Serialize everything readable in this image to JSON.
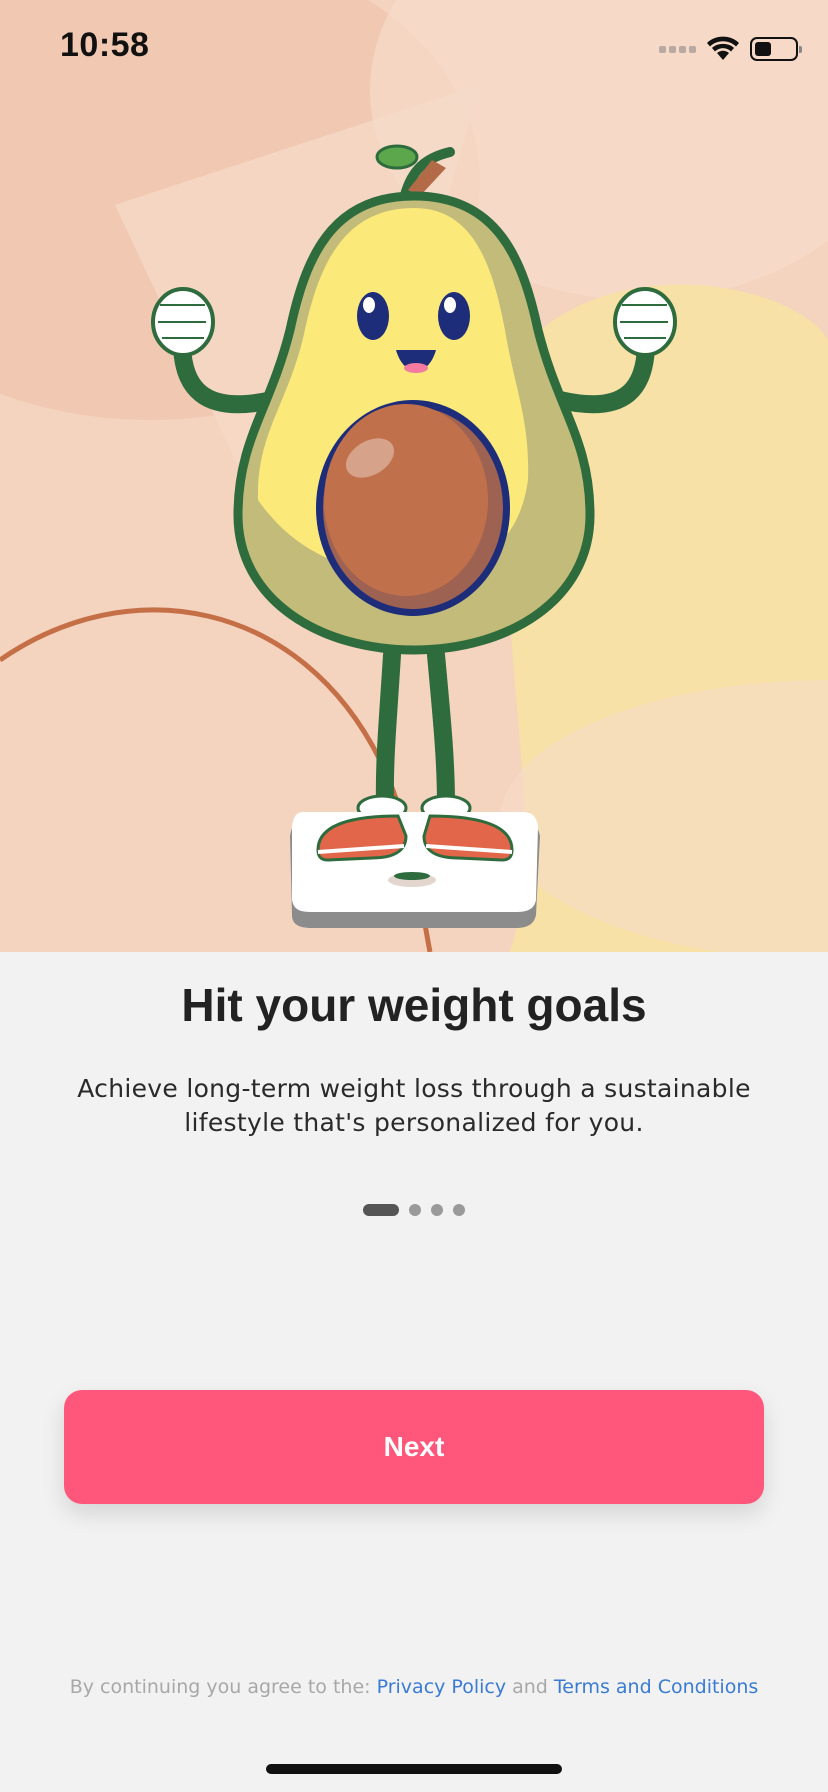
{
  "status_bar": {
    "time": "10:58",
    "icons": [
      "cellular-signal-icon",
      "wifi-icon",
      "battery-icon"
    ],
    "battery_level": 0.4
  },
  "hero": {
    "illustration": "avocado-on-scale-illustration",
    "colors": {
      "background": "#f4d3bf",
      "blob_yellow": "#f7e1a6",
      "avocado_skin": "#2e6b3d",
      "avocado_flesh": "#fbe97a",
      "pit": "#c0714b",
      "shoes": "#e2674a"
    }
  },
  "onboarding": {
    "title": "Hit your weight goals",
    "subtitle": "Achieve long-term weight loss through a sustainable lifestyle that's personalized for you.",
    "page_count": 4,
    "current_page": 1
  },
  "actions": {
    "next_label": "Next",
    "accent_color": "#ff577c"
  },
  "legal": {
    "prefix": "By continuing you agree to the:",
    "privacy_label": "Privacy Policy",
    "conjunction": "and",
    "terms_label": "Terms and Conditions",
    "link_color": "#3a7bd5"
  }
}
